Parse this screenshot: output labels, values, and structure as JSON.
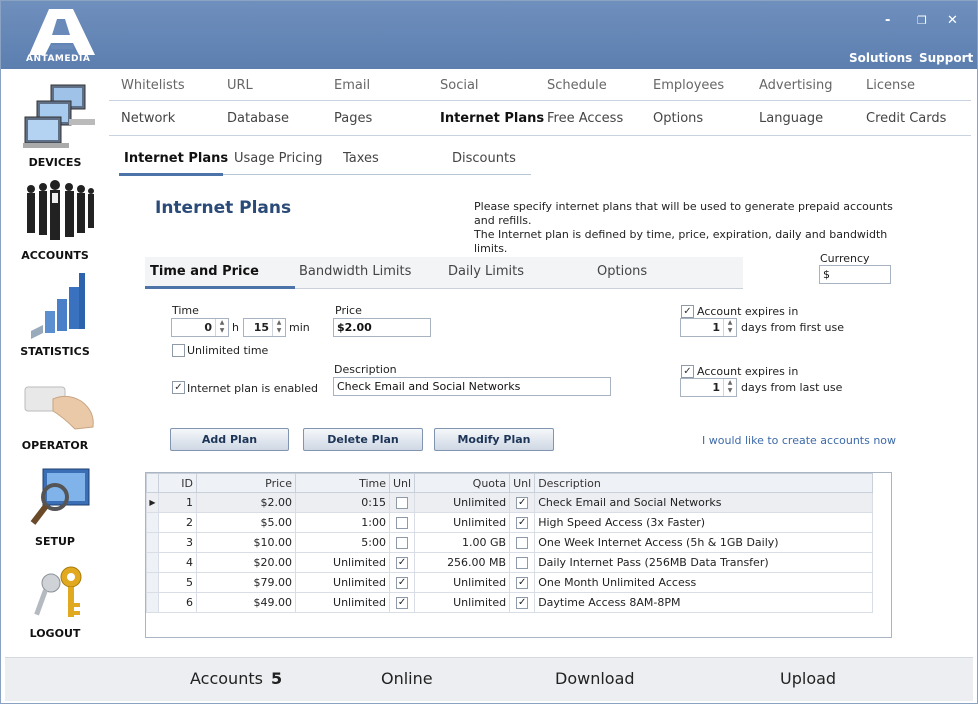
{
  "brand": {
    "name": "ANTAMEDIA"
  },
  "window": {
    "minimize": "-",
    "maximize": "❐",
    "close": "✕"
  },
  "top_links": {
    "solutions": "Solutions",
    "support": "Support"
  },
  "sidebar": {
    "items": [
      {
        "label": "DEVICES"
      },
      {
        "label": "ACCOUNTS"
      },
      {
        "label": "STATISTICS"
      },
      {
        "label": "OPERATOR"
      },
      {
        "label": "SETUP"
      },
      {
        "label": "LOGOUT"
      }
    ]
  },
  "menu": {
    "row1": [
      "Whitelists",
      "URL",
      "Email",
      "Social",
      "Schedule",
      "Employees",
      "Advertising",
      "License"
    ],
    "row2": [
      "Network",
      "Database",
      "Pages",
      "Internet Plans",
      "Free Access",
      "Options",
      "Language",
      "Credit Cards"
    ],
    "active": "Internet Plans"
  },
  "subtabs": [
    "Internet Plans",
    "Usage Pricing",
    "Taxes",
    "Discounts"
  ],
  "page": {
    "title": "Internet Plans",
    "desc_line1": "Please specify internet plans that will be used to generate prepaid accounts and refills.",
    "desc_line2": "The Internet plan is defined by time, price, expiration, daily and bandwidth limits."
  },
  "inner_tabs": [
    "Time and Price",
    "Bandwidth Limits",
    "Daily Limits",
    "Options"
  ],
  "currency": {
    "label": "Currency",
    "value": "$"
  },
  "form": {
    "time_label": "Time",
    "hours": "0",
    "h_unit": "h",
    "minutes": "15",
    "min_unit": "min",
    "unlimited_time": "Unlimited time",
    "plan_enabled": "Internet plan is enabled",
    "price_label": "Price",
    "price_value": "$2.00",
    "description_label": "Description",
    "description_value": "Check Email and Social Networks",
    "expires_label": "Account expires in",
    "expires_first_value": "1",
    "expires_first_unit": "days from first use",
    "expires_last_value": "1",
    "expires_last_unit": "days from last use"
  },
  "buttons": {
    "add": "Add Plan",
    "delete": "Delete Plan",
    "modify": "Modify Plan"
  },
  "create_link": "I would like to create accounts now",
  "table": {
    "headers": [
      "ID",
      "Price",
      "Time",
      "Unl",
      "Quota",
      "Unl",
      "Description"
    ],
    "rows": [
      {
        "id": "1",
        "price": "$2.00",
        "time": "0:15",
        "time_unl": false,
        "quota": "Unlimited",
        "quota_unl": true,
        "desc": "Check Email and Social Networks"
      },
      {
        "id": "2",
        "price": "$5.00",
        "time": "1:00",
        "time_unl": false,
        "quota": "Unlimited",
        "quota_unl": true,
        "desc": "High Speed Access (3x Faster)"
      },
      {
        "id": "3",
        "price": "$10.00",
        "time": "5:00",
        "time_unl": false,
        "quota": "1.00 GB",
        "quota_unl": false,
        "desc": "One Week Internet Access (5h & 1GB Daily)"
      },
      {
        "id": "4",
        "price": "$20.00",
        "time": "Unlimited",
        "time_unl": true,
        "quota": "256.00 MB",
        "quota_unl": false,
        "desc": "Daily Internet Pass (256MB Data Transfer)"
      },
      {
        "id": "5",
        "price": "$79.00",
        "time": "Unlimited",
        "time_unl": true,
        "quota": "Unlimited",
        "quota_unl": true,
        "desc": "One Month Unlimited Access"
      },
      {
        "id": "6",
        "price": "$49.00",
        "time": "Unlimited",
        "time_unl": true,
        "quota": "Unlimited",
        "quota_unl": true,
        "desc": "Daytime Access 8AM-8PM"
      }
    ]
  },
  "status": {
    "accounts_label": "Accounts",
    "accounts_value": "5",
    "online_label": "Online",
    "download_label": "Download",
    "upload_label": "Upload"
  },
  "colors": {
    "titlebar": "#5c7fb0",
    "accent": "#4d74a8",
    "title_text": "#2a4a77"
  }
}
